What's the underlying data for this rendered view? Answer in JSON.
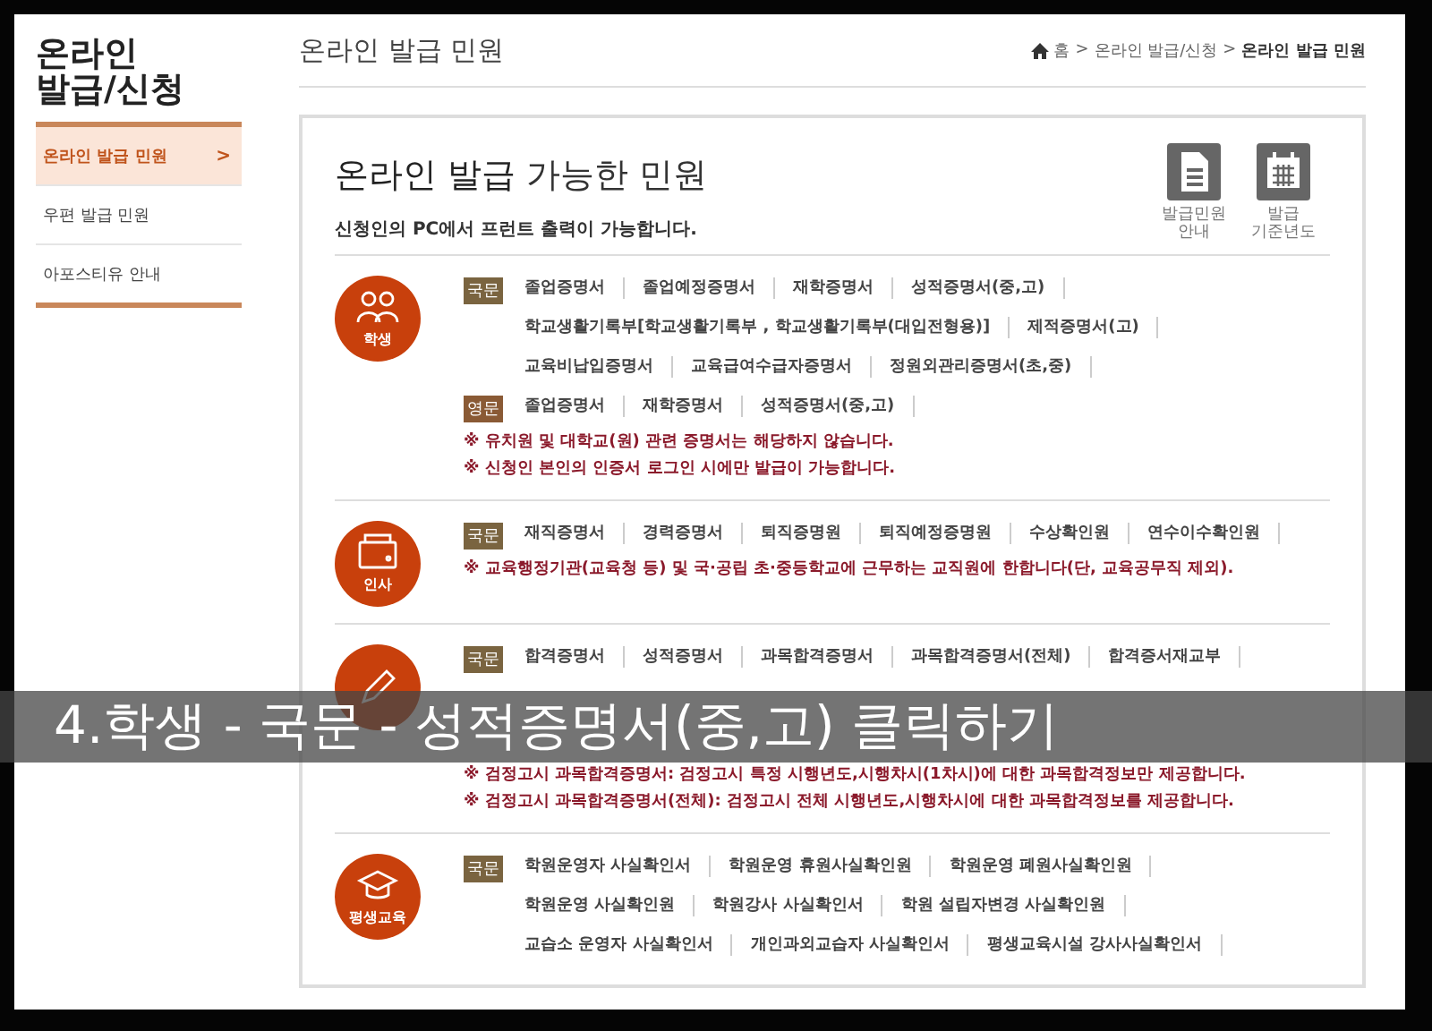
{
  "sidebar": {
    "title_lines": [
      "온라인",
      "발급/신청"
    ],
    "items": [
      {
        "label": "온라인 발급 민원",
        "selected": true,
        "arrow": ">"
      },
      {
        "label": "우편 발급 민원",
        "selected": false
      },
      {
        "label": "아포스티유 안내",
        "selected": false
      }
    ]
  },
  "page_title": "온라인 발급 민원",
  "breadcrumb": [
    "홈",
    ">",
    "온라인 발급/신청",
    ">",
    "온라인 발급 민원"
  ],
  "card": {
    "title_plain": "온라인 발급",
    "title_light": "가능한 민원",
    "subtitle": "신청인의 PC에서 프런트 출력이 가능합니다.",
    "tools": [
      {
        "kind": "document",
        "label_lines": [
          "발급민원",
          "안내"
        ]
      },
      {
        "kind": "calendar",
        "label_lines": [
          "발급",
          "기준년도"
        ]
      }
    ],
    "sections": [
      {
        "kind": "students",
        "label": "학생",
        "groups": [
          {
            "tag": "국문",
            "color": "#7a6440",
            "items": [
              "졸업증명서",
              "졸업예정증명서",
              "재학증명서",
              "성적증명서(중,고)",
              "학교생활기록부[학교생활기록부 , 학교생활기록부(대입전형용)]",
              "제적증명서(고)",
              "교육비납입증명서",
              "교육급여수급자증명서",
              "정원외관리증명서(초,중)"
            ]
          },
          {
            "tag": "영문",
            "color": "#8a5a35",
            "items": [
              "졸업증명서",
              "재학증명서",
              "성적증명서(중,고)"
            ]
          }
        ],
        "notes": [
          "※ 유치원 및 대학교(원) 관련 증명서는 해당하지 않습니다.",
          "※ 신청인 본인의 인증서 로그인 시에만 발급이 가능합니다."
        ]
      },
      {
        "kind": "wallet",
        "label": "인사",
        "groups": [
          {
            "tag": "국문",
            "color": "#7a6440",
            "items": [
              "재직증명서",
              "경력증명서",
              "퇴직증명원",
              "퇴직예정증명원",
              "수상확인원",
              "연수이수확인원"
            ]
          }
        ],
        "notes": [
          "※ 교육행정기관(교육청 등) 및 국·공립 초·중등학교에 근무하는 교직원에 한합니다(단, 교육공무직 제외)."
        ]
      },
      {
        "kind": "pencil",
        "groups": [
          {
            "tag": "국문",
            "color": "#7a6440",
            "items": [
              "합격증명서",
              "성적증명서",
              "과목합격증명서",
              "과목합격증명서(전체)",
              "합격증서재교부"
            ]
          }
        ],
        "notes": [
          "※ 검정고시 과목합격증명서: 검정고시 특정 시행년도,시행차시(1차시)에 대한 과목합격정보만 제공합니다.",
          "※ 검정고시 과목합격증명서(전체): 검정고시 전체 시행년도,시행차시에 대한 과목합격정보를 제공합니다."
        ]
      },
      {
        "kind": "graduation-cap",
        "label": "평생교육",
        "groups": [
          {
            "tag": "국문",
            "color": "#7a6440",
            "items": [
              "학원운영자 사실확인서",
              "학원운영 휴원사실확인원",
              "학원운영 폐원사실확인원",
              "학원운영 사실확인원",
              "학원강사 사실확인서",
              "학원 설립자변경 사실확인원",
              "교습소 운영자 사실확인서",
              "개인과외교습자 사실확인서",
              "평생교육시설 강사사실확인서"
            ]
          }
        ]
      }
    ]
  },
  "caption": "4.학생 - 국문 - 성적증명서(중,고) 클릭하기"
}
